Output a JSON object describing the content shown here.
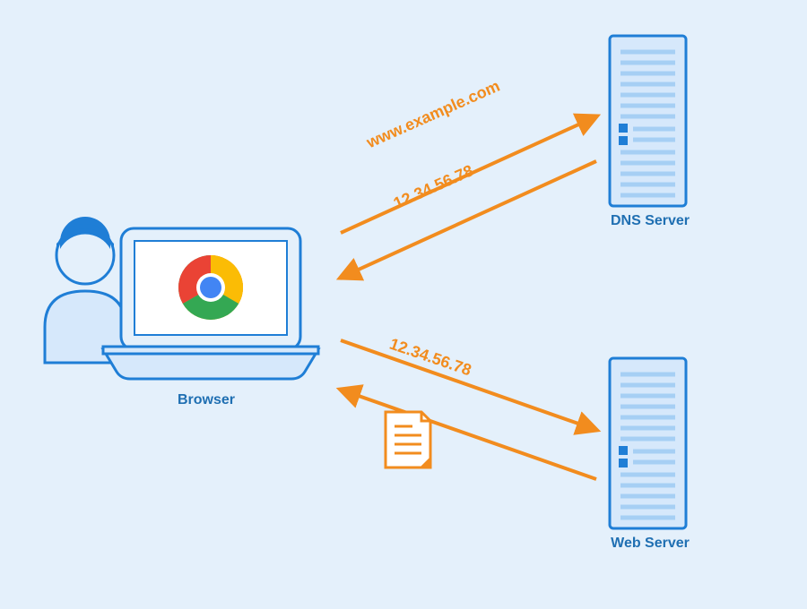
{
  "nodes": {
    "browser": {
      "label": "Browser"
    },
    "dns": {
      "label": "DNS Server"
    },
    "web": {
      "label": "Web Server"
    }
  },
  "arrows": {
    "to_dns_label": "www.example.com",
    "from_dns_label": "12.34.56.78",
    "to_web_label": "12.34.56.78"
  },
  "colors": {
    "bg": "#e4f0fb",
    "blue_stroke": "#1f7ed6",
    "blue_fill_light": "#d6e8fb",
    "blue_fill_mid": "#a6cff4",
    "blue_text": "#1f6fb2",
    "orange": "#f28c1e",
    "white": "#ffffff",
    "chrome_red": "#ea4335",
    "chrome_yellow": "#fbbc05",
    "chrome_green": "#34a853",
    "chrome_blue": "#4285f4"
  }
}
